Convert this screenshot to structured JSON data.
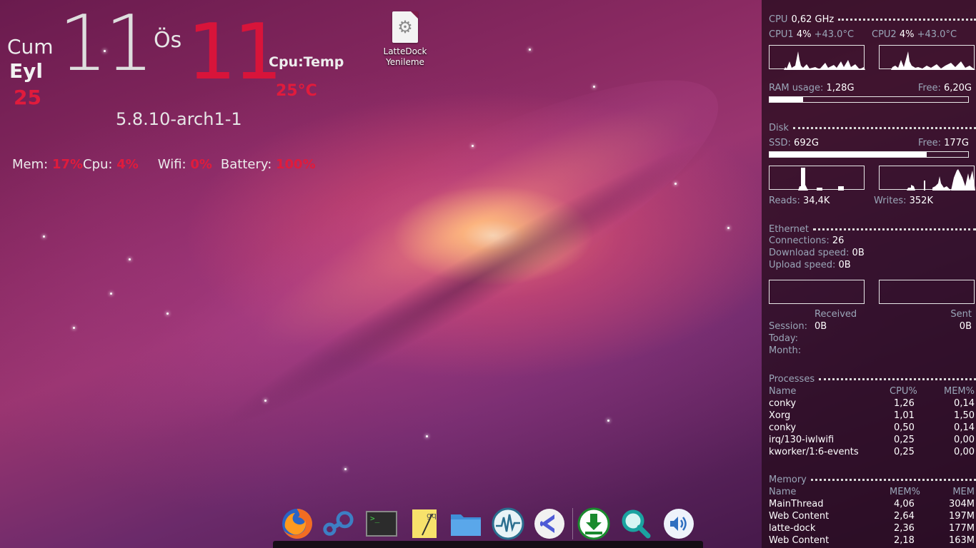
{
  "clock": {
    "day_name": "Cum",
    "month_name": "Eyl",
    "day_number": "25",
    "hour": "11",
    "ampm": "Ös",
    "minute": "11",
    "cpu_temp_label": "Cpu:Temp",
    "cpu_temp_value": "25°C",
    "kernel": "5.8.10-arch1-1"
  },
  "stats": {
    "mem_label": "Mem: ",
    "mem_value": "17%",
    "cpu_label": "Cpu: ",
    "cpu_value": "4%",
    "wifi_label": "Wifi: ",
    "wifi_value": "0%",
    "battery_label": "Battery: ",
    "battery_value": "100%"
  },
  "desktop_file": {
    "label_line1": "LatteDock",
    "label_line2": "Yenileme",
    "icon": "gear-icon"
  },
  "conky": {
    "cpu": {
      "title": "CPU",
      "freq": "0,62 GHz",
      "cpu1_label": "CPU1",
      "cpu1_usage": "4%",
      "cpu1_temp": "+43.0°C",
      "cpu2_label": "CPU2",
      "cpu2_usage": "4%",
      "cpu2_temp": "+43.0°C"
    },
    "ram": {
      "label": "RAM usage:",
      "used": "1,28G",
      "free_label": "Free:",
      "free": "6,20G",
      "percent": 17
    },
    "disk": {
      "title": "Disk",
      "ssd_label": "SSD:",
      "ssd_used": "692G",
      "free_label": "Free:",
      "free": "177G",
      "percent": 79,
      "reads_label": "Reads:",
      "reads": "34,4K",
      "writes_label": "Writes:",
      "writes": "352K"
    },
    "ethernet": {
      "title": "Ethernet",
      "connections_label": "Connections:",
      "connections": "26",
      "download_label": "Download speed:",
      "download": "0B",
      "upload_label": "Upload speed:",
      "upload": "0B",
      "received_label": "Received",
      "sent_label": "Sent",
      "session_label": "Session:",
      "session_received": "0B",
      "session_sent": "0B",
      "today_label": "Today:",
      "month_label": "Month:"
    },
    "processes": {
      "title": "Processes",
      "columns": [
        "Name",
        "CPU%",
        "MEM%"
      ],
      "rows": [
        {
          "name": "conky",
          "cpu": "1,26",
          "mem": "0,14"
        },
        {
          "name": "Xorg",
          "cpu": "1,01",
          "mem": "1,50"
        },
        {
          "name": "conky",
          "cpu": "0,50",
          "mem": "0,14"
        },
        {
          "name": "irq/130-iwlwifi",
          "cpu": "0,25",
          "mem": "0,00"
        },
        {
          "name": "kworker/1:6-events",
          "cpu": "0,25",
          "mem": "0,00"
        }
      ]
    },
    "memory": {
      "title": "Memory",
      "columns": [
        "Name",
        "MEM%",
        "MEM"
      ],
      "rows": [
        {
          "name": "MainThread",
          "pct": "4,06",
          "mem": "304M"
        },
        {
          "name": "Web Content",
          "pct": "2,64",
          "mem": "197M"
        },
        {
          "name": "latte-dock",
          "pct": "2,36",
          "mem": "177M"
        },
        {
          "name": "Web Content",
          "pct": "2,18",
          "mem": "163M"
        }
      ]
    }
  },
  "dock": {
    "items": [
      {
        "icon": "firefox-icon"
      },
      {
        "icon": "steam-icon"
      },
      {
        "icon": "terminal-icon",
        "glyph": ">_"
      },
      {
        "icon": "text-editor-icon"
      },
      {
        "icon": "file-manager-icon"
      },
      {
        "icon": "system-monitor-icon"
      },
      {
        "icon": "visual-studio-code-icon"
      },
      {
        "icon": "download-manager-icon"
      },
      {
        "icon": "search-tool-icon"
      },
      {
        "icon": "volume-icon"
      }
    ]
  },
  "colors": {
    "accent_red": "#e01b3c",
    "label_blue_gray": "#9aa6b8",
    "conky_background": "#260c1e"
  }
}
